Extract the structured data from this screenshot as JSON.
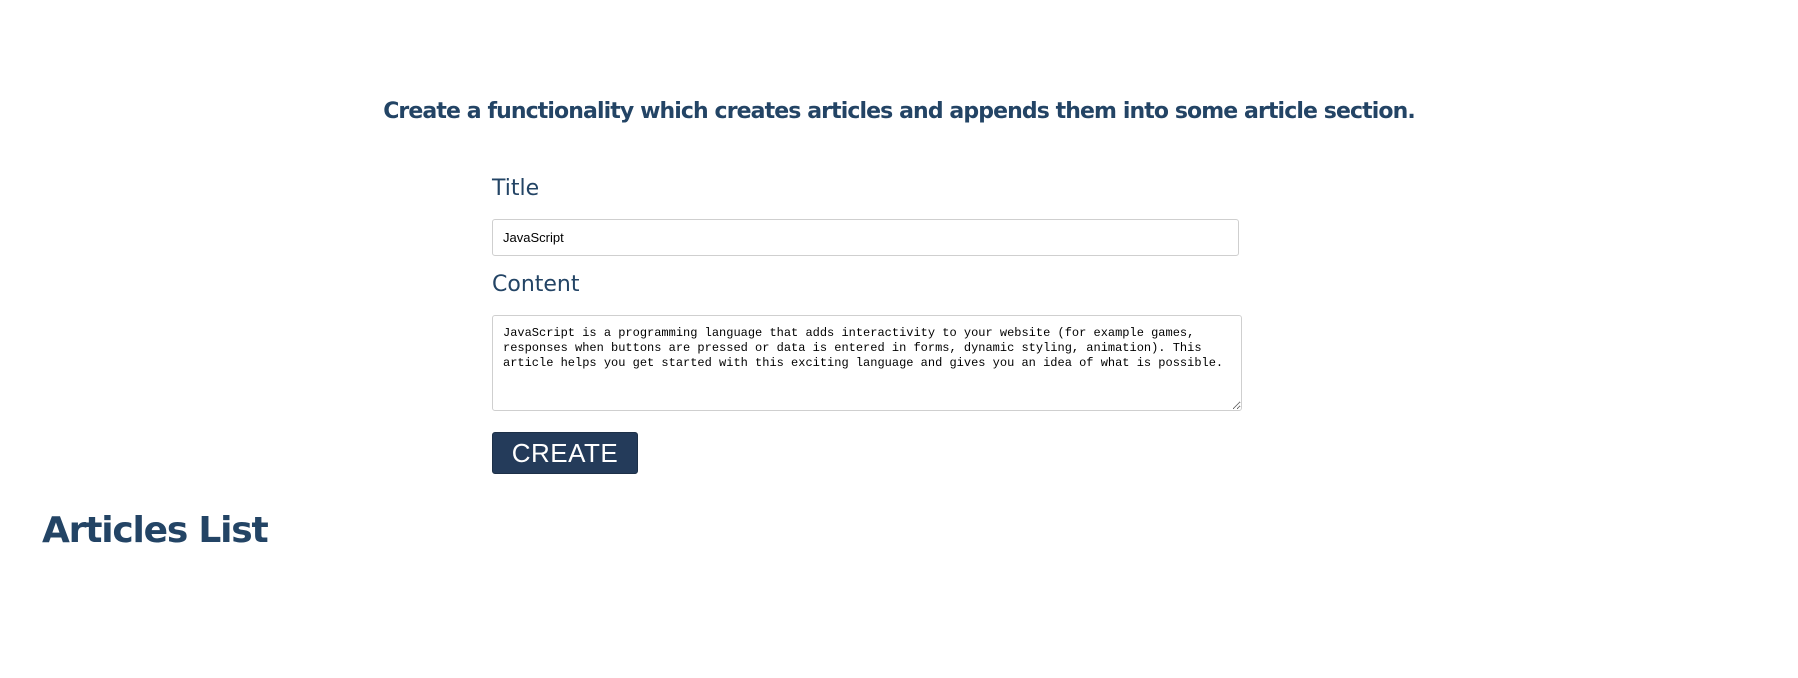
{
  "header": {
    "heading": "Create a functionality which creates articles and appends them into some article section."
  },
  "form": {
    "title_label": "Title",
    "title_value": "JavaScript",
    "content_label": "Content",
    "content_value": "JavaScript is a programming language that adds interactivity to your website (for example games, responses when buttons are pressed or data is entered in forms, dynamic styling, animation). This article helps you get started with this exciting language and gives you an idea of what is possible.",
    "create_label": "CREATE"
  },
  "articles": {
    "heading": "Articles List",
    "items": []
  },
  "colors": {
    "text": "#234465",
    "button_bg": "#243b5a",
    "button_text": "#ffffff"
  }
}
